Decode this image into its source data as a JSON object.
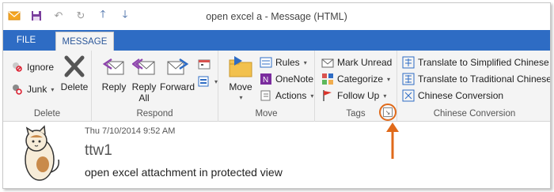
{
  "window": {
    "title": "open excel a - Message (HTML)"
  },
  "qat": {
    "icons": [
      "envelope-icon",
      "save-icon",
      "undo-icon",
      "redo-icon",
      "previous-item-icon",
      "next-item-icon"
    ]
  },
  "tabs": {
    "file": "FILE",
    "message": "MESSAGE"
  },
  "ribbon": {
    "delete_group": {
      "label": "Delete",
      "ignore": "Ignore",
      "junk": "Junk",
      "delete": "Delete"
    },
    "respond_group": {
      "label": "Respond",
      "reply": "Reply",
      "reply_all_1": "Reply",
      "reply_all_2": "All",
      "forward": "Forward"
    },
    "move_group": {
      "label": "Move",
      "move": "Move",
      "rules": "Rules",
      "onenote": "OneNote",
      "actions": "Actions"
    },
    "tags_group": {
      "label": "Tags",
      "mark_unread": "Mark Unread",
      "categorize": "Categorize",
      "follow_up": "Follow Up"
    },
    "chinese_group": {
      "label": "Chinese Conversion",
      "to_simplified": "Translate to Simplified Chinese",
      "to_traditional": "Translate to Traditional Chinese",
      "conversion": "Chinese Conversion"
    }
  },
  "message": {
    "date": "Thu 7/10/2014 9:52 AM",
    "from": "ttw1",
    "subject": "open excel attachment in protected view"
  },
  "colors": {
    "accent": "#2e6cc4",
    "highlight": "#e06a1a"
  }
}
